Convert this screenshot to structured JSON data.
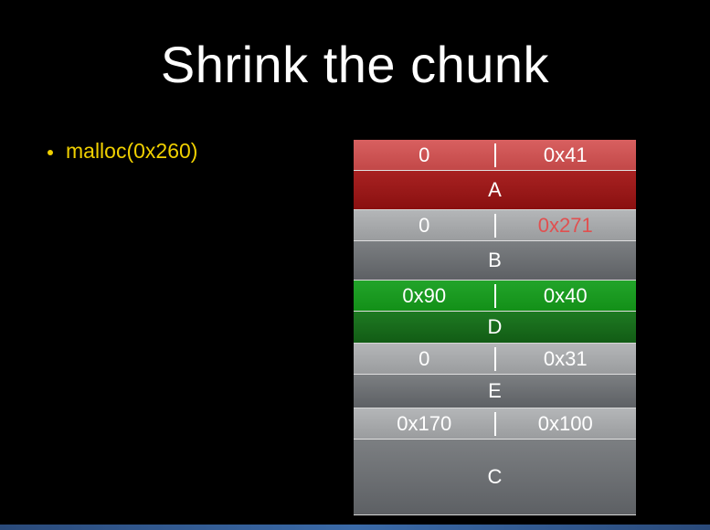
{
  "slide": {
    "title": "Shrink the chunk",
    "bullets": [
      "malloc(0x260)"
    ]
  },
  "heap": {
    "chunks": [
      {
        "name": "A",
        "prev_size": "0",
        "size": "0x41",
        "color": "red",
        "size_color": "#ffffff"
      },
      {
        "name": "B",
        "prev_size": "0",
        "size": "0x271",
        "color": "gray",
        "size_color": "#e05050"
      },
      {
        "name": "D",
        "prev_size": "0x90",
        "size": "0x40",
        "color": "green",
        "size_color": "#ffffff"
      },
      {
        "name": "E",
        "prev_size": "0",
        "size": "0x31",
        "color": "gray",
        "size_color": "#ffffff"
      },
      {
        "name": "C",
        "prev_size": "0x170",
        "size": "0x100",
        "color": "gray",
        "size_color": "#ffffff"
      }
    ]
  },
  "colors": {
    "background": "#000000",
    "title": "#ffffff",
    "bullet": "#f0d000",
    "chunk_red_header": "#c24848",
    "chunk_red_body": "#8a1010",
    "chunk_gray_header": "#9a9c9e",
    "chunk_gray_body": "#5d6064",
    "chunk_green_header": "#139018",
    "chunk_green_body": "#125c15",
    "highlight": "#e05050"
  }
}
